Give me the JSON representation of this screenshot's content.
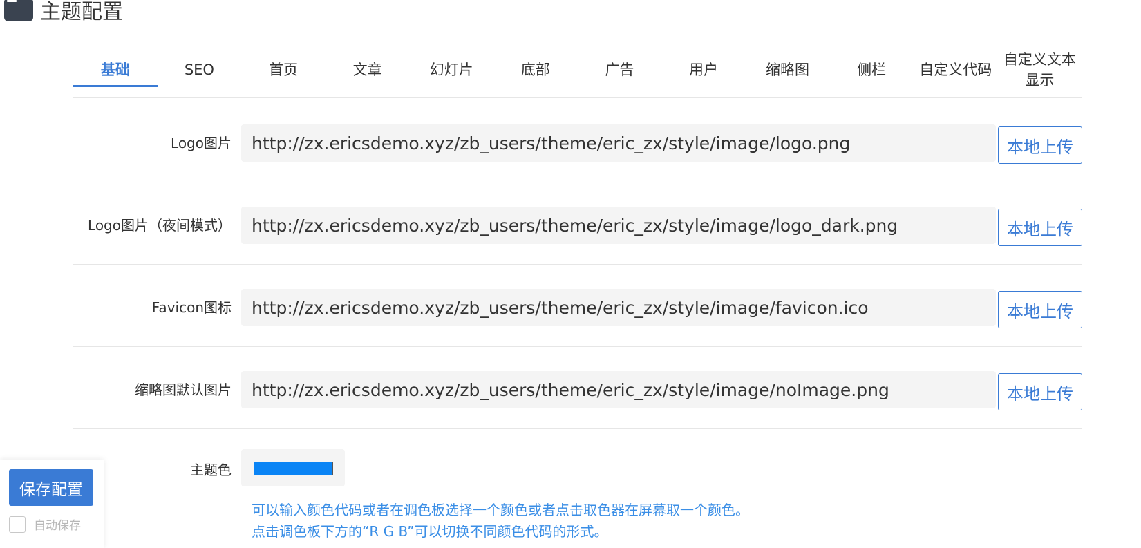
{
  "header": {
    "title": "主题配置",
    "icon": "window-icon"
  },
  "tabs": [
    {
      "label": "基础",
      "active": true
    },
    {
      "label": "SEO"
    },
    {
      "label": "首页"
    },
    {
      "label": "文章"
    },
    {
      "label": "幻灯片"
    },
    {
      "label": "底部"
    },
    {
      "label": "广告"
    },
    {
      "label": "用户"
    },
    {
      "label": "缩略图"
    },
    {
      "label": "侧栏"
    },
    {
      "label": "自定义代码"
    },
    {
      "label": "自定义文本显示"
    }
  ],
  "fields": [
    {
      "label": "Logo图片",
      "value": "http://zx.ericsdemo.xyz/zb_users/theme/eric_zx/style/image/logo.png",
      "button": "本地上传"
    },
    {
      "label": "Logo图片（夜间模式）",
      "value": "http://zx.ericsdemo.xyz/zb_users/theme/eric_zx/style/image/logo_dark.png",
      "button": "本地上传"
    },
    {
      "label": "Favicon图标",
      "value": "http://zx.ericsdemo.xyz/zb_users/theme/eric_zx/style/image/favicon.ico",
      "button": "本地上传"
    },
    {
      "label": "缩略图默认图片",
      "value": "http://zx.ericsdemo.xyz/zb_users/theme/eric_zx/style/image/noImage.png",
      "button": "本地上传"
    }
  ],
  "theme_color": {
    "label": "主题色",
    "color": "#0a84f5",
    "hint_1": "可以输入颜色代码或者在调色板选择一个颜色或者点击取色器在屏幕取一个颜色。",
    "hint_2": "点击调色板下方的“R G B”可以切换不同颜色代码的形式。"
  },
  "save": {
    "button": "保存配置",
    "auto_save_label": "自动保存"
  },
  "colors": {
    "accent": "#3a7bd5",
    "hint": "#3a8ee6",
    "input_bg": "#f4f4f4"
  }
}
